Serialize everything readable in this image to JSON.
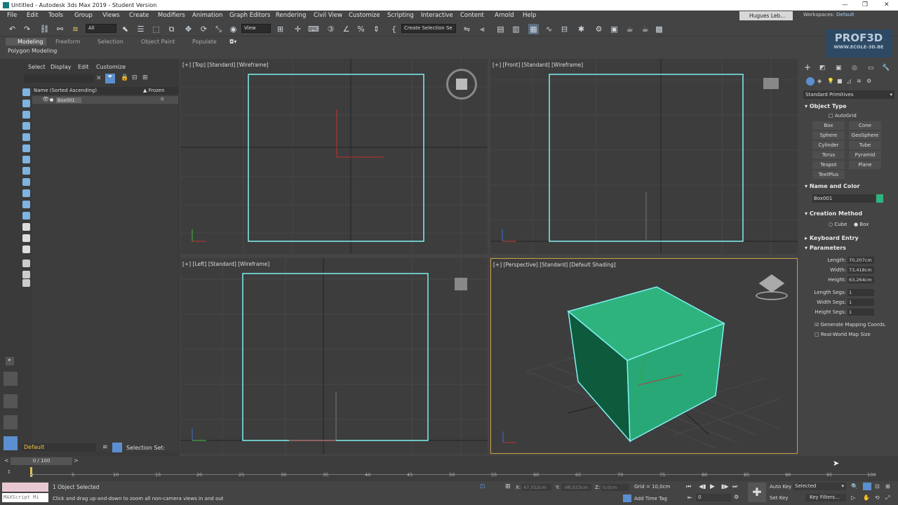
{
  "window": {
    "title": "Untitled - Autodesk 3ds Max 2019 - Student Version"
  },
  "menu": [
    "File",
    "Edit",
    "Tools",
    "Group",
    "Views",
    "Create",
    "Modifiers",
    "Animation",
    "Graph Editors",
    "Rendering",
    "Civil View",
    "Customize",
    "Scripting",
    "Interactive",
    "Content",
    "Arnold",
    "Help"
  ],
  "user": {
    "name": "Hugues Leb...",
    "workspace_label": "Workspaces:",
    "workspace_value": "Default"
  },
  "toolbar": {
    "filter": "All",
    "ref_coord": "View",
    "selection_set": "Create Selection Se"
  },
  "ribbon": {
    "tabs": [
      "Modeling",
      "Freeform",
      "Selection",
      "Object Paint",
      "Populate"
    ],
    "sub": "Polygon Modeling"
  },
  "scene_explorer": {
    "menu": [
      "Select",
      "Display",
      "Edit",
      "Customize"
    ],
    "col_name": "Name (Sorted Ascending)",
    "col_frozen": "▲ Frozen",
    "items": [
      "Box001"
    ],
    "layer": "Default",
    "selection_set_label": "Selection Set:"
  },
  "viewports": {
    "top": "[+] [Top] [Standard] [Wireframe]",
    "front": "[+] [Front] [Standard] [Wireframe]",
    "left": "[+] [Left] [Standard] [Wireframe]",
    "perspective": "[+] [Perspective] [Standard] [Default Shading]"
  },
  "command_panel": {
    "category": "Standard Primitives",
    "object_type": "Object Type",
    "autogrid": "AutoGrid",
    "buttons": [
      "Box",
      "Cone",
      "Sphere",
      "GeoSphere",
      "Cylinder",
      "Tube",
      "Torus",
      "Pyramid",
      "Teapot",
      "Plane",
      "TextPlus"
    ],
    "name_color": "Name and Color",
    "object_name": "Box001",
    "object_color": "#2fb37e",
    "creation_method": "Creation Method",
    "cm_options": [
      "Cube",
      "Box"
    ],
    "keyboard_entry": "Keyboard Entry",
    "parameters": "Parameters",
    "params": [
      {
        "label": "Length:",
        "value": "70,207cm"
      },
      {
        "label": "Width:",
        "value": "73,418cm"
      },
      {
        "label": "Height:",
        "value": "63,264cm"
      }
    ],
    "segs": [
      {
        "label": "Length Segs:",
        "value": "1"
      },
      {
        "label": "Width Segs:",
        "value": "1"
      },
      {
        "label": "Height Segs:",
        "value": "1"
      }
    ],
    "gen_mapping": "Generate Mapping Coords.",
    "real_world": "Real-World Map Size"
  },
  "timeline": {
    "frame": "0 / 100",
    "ticks": [
      "0",
      "5",
      "10",
      "15",
      "20",
      "25",
      "30",
      "35",
      "40",
      "45",
      "50",
      "55",
      "60",
      "65",
      "70",
      "75",
      "80",
      "85",
      "90",
      "95",
      "100"
    ]
  },
  "status": {
    "maxscript": "MAXScript Mi",
    "selected": "1 Object Selected",
    "hint": "Click and drag up-and-down to zoom all non-camera views in and out",
    "x_label": "X:",
    "x": "47,552cm",
    "y_label": "Y:",
    "y": "-98,023cm",
    "z_label": "Z:",
    "z": "0,0cm",
    "grid": "Grid = 10,0cm",
    "add_time_tag": "Add Time Tag",
    "auto_key": "Auto Key",
    "set_key": "Set Key",
    "selected_dd": "Selected",
    "key_filters": "Key Filters...",
    "frame_input": "0"
  },
  "watermark": {
    "line1": "PROF3D",
    "line2": "WWW.ECOLE-3D.BE"
  },
  "colors": {
    "wire": "#7ff0f0",
    "box_face": "#2fb37e",
    "active_border": "#c8a04a"
  }
}
